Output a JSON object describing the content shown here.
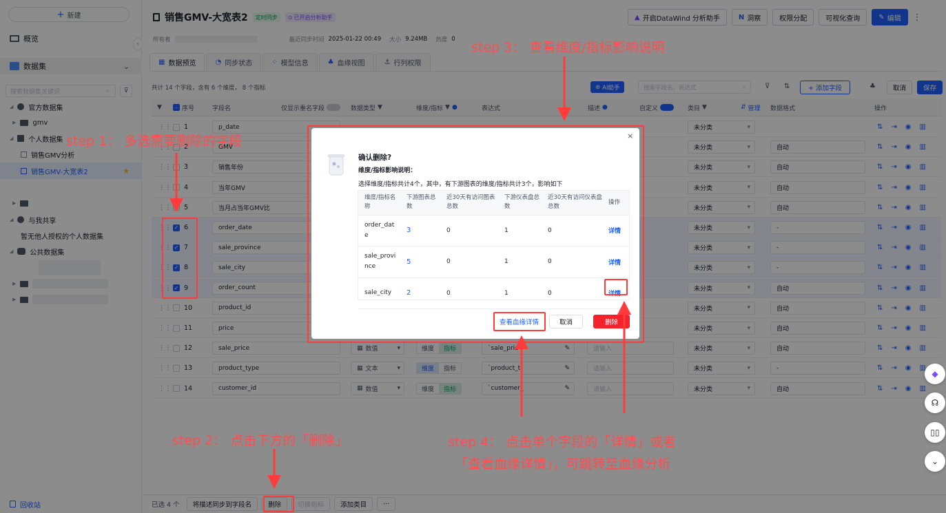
{
  "sidebar": {
    "new_label": "新建",
    "overview": "概览",
    "datasets": "数据集",
    "search_placeholder": "搜索数据集关键词",
    "official": "官方数据集",
    "gmv_folder": "gmv",
    "personal": "个人数据集",
    "item1": "销售GMV分析",
    "item2": "销售GMV-大宽表2",
    "shared": "与我共享",
    "shared_empty": "暂无他人授权的个人数据集",
    "public": "公共数据集",
    "recycle": "回收站"
  },
  "header": {
    "title": "销售GMV-大宽表2",
    "tag_sync": "定时同步",
    "tag_ai": "已开启分析助手",
    "owner_label": "所有者",
    "recent_label": "最近同步时间",
    "recent_value": "2025-01-22 00:49",
    "size_label": "大小",
    "size_value": "9.24MB",
    "heat_label": "热度",
    "heat_value": "0",
    "btn_datawind": "开启DataWind 分析助手",
    "btn_insight": "洞察",
    "btn_perm": "权限分配",
    "btn_vis": "可视化查询",
    "btn_edit": "编辑"
  },
  "tabs": [
    "数据预览",
    "同步状态",
    "模型信息",
    "血缘视图",
    "行列权限"
  ],
  "toolbar": {
    "summary": "共计 14 个字段，含有 6 个维度， 8 个指标",
    "ai_btn": "AI助手",
    "search_placeholder": "搜索字段名、表达式",
    "add_field": "+ 添加字段",
    "cancel": "取消",
    "save": "保存"
  },
  "columns": {
    "seq": "序号",
    "field": "字段名",
    "only_dup": "仅显示重名字段",
    "dtype": "数据类型",
    "dim": "维度/指标",
    "expr": "表达式",
    "desc": "描述",
    "custom": "自定义",
    "category": "类目",
    "manage": "管理",
    "format": "数据格式",
    "ops": "操作"
  },
  "rows": [
    {
      "n": "1",
      "name": "p_date",
      "cat": "未分类",
      "fmt": ""
    },
    {
      "n": "2",
      "name": "GMV",
      "cat": "未分类",
      "fmt": "自动"
    },
    {
      "n": "3",
      "name": "销售年份",
      "cat": "未分类",
      "fmt": "自动"
    },
    {
      "n": "4",
      "name": "当年GMV",
      "cat": "未分类",
      "fmt": "自动"
    },
    {
      "n": "5",
      "name": "当月占当年GMV比",
      "cat": "未分类",
      "fmt": "自动"
    },
    {
      "n": "6",
      "name": "order_date",
      "cat": "未分类",
      "fmt": "-"
    },
    {
      "n": "7",
      "name": "sale_province",
      "cat": "未分类",
      "fmt": "-"
    },
    {
      "n": "8",
      "name": "sale_city",
      "cat": "未分类",
      "fmt": "-"
    },
    {
      "n": "9",
      "name": "order_count",
      "cat": "未分类",
      "fmt": "自动"
    },
    {
      "n": "10",
      "name": "product_id",
      "cat": "未分类",
      "fmt": "自动"
    },
    {
      "n": "11",
      "name": "price",
      "cat": "未分类",
      "fmt": "自动"
    },
    {
      "n": "12",
      "name": "sale_price",
      "cat": "未分类",
      "fmt": "自动",
      "dtype": "数值",
      "expr": "`sale_pric",
      "desc": "请输入"
    },
    {
      "n": "13",
      "name": "product_type",
      "cat": "未分类",
      "fmt": "-",
      "dtype": "文本",
      "expr": "`product_t",
      "desc": "请输入"
    },
    {
      "n": "14",
      "name": "customer_id",
      "cat": "未分类",
      "fmt": "自动",
      "dtype": "数值",
      "expr": "`customer_",
      "desc": "请输入"
    }
  ],
  "seg": {
    "dim": "维度",
    "metric": "指标"
  },
  "bottom": {
    "selected": "已选 4 个",
    "sync_desc": "将描述同步到字段名",
    "delete": "删除",
    "switch": "切换指标",
    "add_cat": "添加类目",
    "more": "···"
  },
  "dialog": {
    "title": "确认删除?",
    "subtitle": "维度/指标影响说明：",
    "desc": "选择维度/指标共计4个，其中，有下游图表的维度/指标共计3个，影响如下",
    "headers": [
      "维度/指标名称",
      "下游图表总数",
      "近30天有访问图表总数",
      "下游仪表盘总数",
      "近30天有访问仪表盘总数",
      "操作"
    ],
    "rows": [
      {
        "name": "order_date",
        "charts": "3",
        "visited": "0",
        "dash": "1",
        "dvisited": "0",
        "op": "详情"
      },
      {
        "name": "sale_province",
        "charts": "5",
        "visited": "0",
        "dash": "1",
        "dvisited": "0",
        "op": "详情"
      },
      {
        "name": "sale_city",
        "charts": "2",
        "visited": "0",
        "dash": "1",
        "dvisited": "0",
        "op": "详情"
      }
    ],
    "btn_lineage": "查看血缘详情",
    "btn_cancel": "取消",
    "btn_delete": "删除"
  },
  "annotations": {
    "step1": "step 1： 多选需要删除的字段",
    "step2": "step 2： 点击下方的「删除」",
    "step3": "step 3： 查看维度/指标影响说明",
    "step4_line1": "step 4： 点击单个字段的「详情」或者",
    "step4_line2": "「查看血缘详情」，可跳转至血缘分析"
  },
  "colors": {
    "accent": "#1f5fff",
    "danger": "#f5222d",
    "annotation": "#ff3b3b"
  }
}
